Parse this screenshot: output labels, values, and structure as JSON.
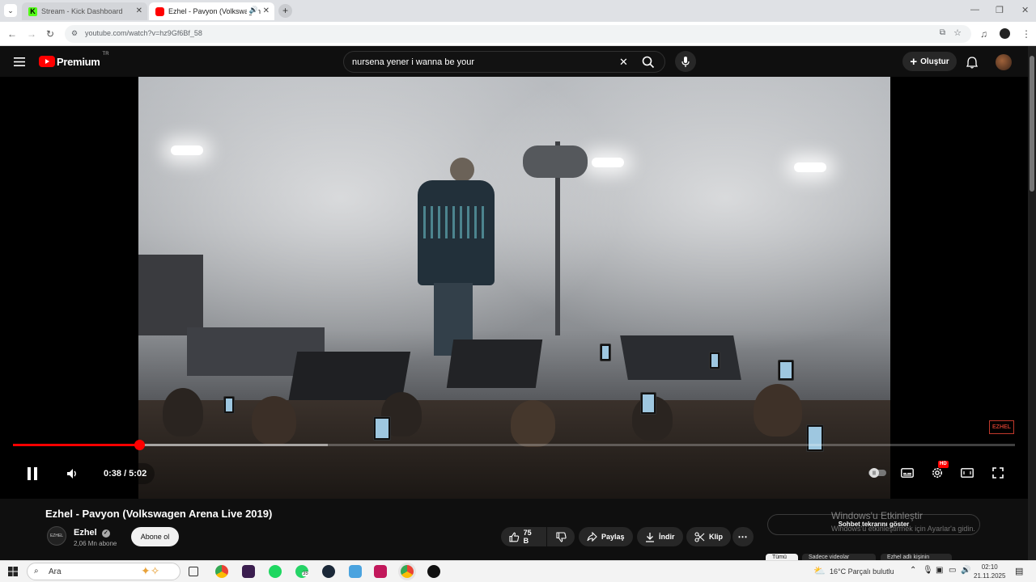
{
  "browser": {
    "tabs": [
      {
        "title": "Stream - Kick Dashboard",
        "active": false
      },
      {
        "title": "Ezhel - Pavyon (Volkswagen",
        "active": true
      }
    ],
    "url": "youtube.com/watch?v=hz9Gf6Bf_58"
  },
  "youtube": {
    "logo_text": "Premium",
    "logo_region": "TR",
    "search_query": "nursena yener i wanna be your",
    "create_label": "Oluştur"
  },
  "player": {
    "time_display": "0:38 / 5:02",
    "progress": 0.126,
    "buffered": 0.314,
    "watermark": "EZHEL",
    "hd_badge": "HD"
  },
  "video": {
    "title": "Ezhel - Pavyon (Volkswagen Arena Live 2019)",
    "channel": "Ezhel",
    "channel_avatar_text": "EZHEL",
    "subscribers": "2,06 Mn abone",
    "subscribe_label": "Abone ol",
    "likes": "75 B",
    "share_label": "Paylaş",
    "download_label": "İndir",
    "clip_label": "Klip",
    "chat_button": "Sohbet tekrarını göster"
  },
  "overlay": {
    "activate_title": "Windows'u Etkinleştir",
    "activate_subtitle": "Windows'u etkinleştirmek için Ayarlar'a gidin."
  },
  "chips": [
    "Tümü",
    "Sadece videolar",
    "Ezhel adlı kişinin"
  ],
  "taskbar": {
    "search_placeholder": "Ara",
    "weather": "16°C  Parçalı bulutlu",
    "time": "02:10",
    "date": "21.11.2025",
    "whatsapp_badge": "35"
  },
  "colors": {
    "accent": "#ff0000",
    "background": "#0f0f0f"
  }
}
